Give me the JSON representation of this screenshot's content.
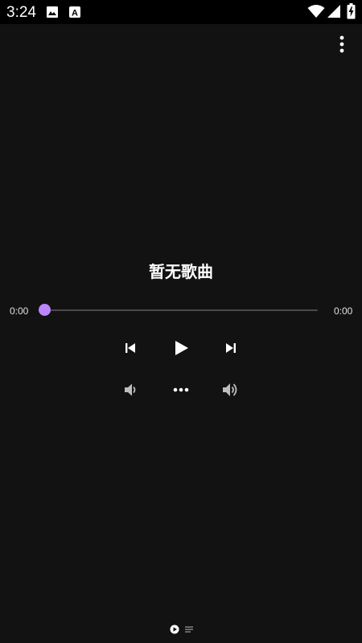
{
  "status_bar": {
    "time": "3:24",
    "icons": [
      "image-icon",
      "a-notification-icon",
      "wifi-icon",
      "signal-icon",
      "battery-charging-icon"
    ]
  },
  "player": {
    "title": "暂无歌曲",
    "elapsed": "0:00",
    "duration": "0:00",
    "progress": 0.0
  },
  "controls": {
    "transport": [
      "skip-previous-icon",
      "play-icon",
      "skip-next-icon"
    ],
    "secondary": [
      "volume-down-icon",
      "more-horizontal-icon",
      "volume-up-icon"
    ]
  },
  "colors": {
    "background": "#121212",
    "status_bar": "#000000",
    "accent": "#bb86fc",
    "track": "#4a4a4a"
  },
  "pager": {
    "pages": [
      "play-circle-icon",
      "lyrics-list-icon"
    ],
    "active_index": 0
  }
}
